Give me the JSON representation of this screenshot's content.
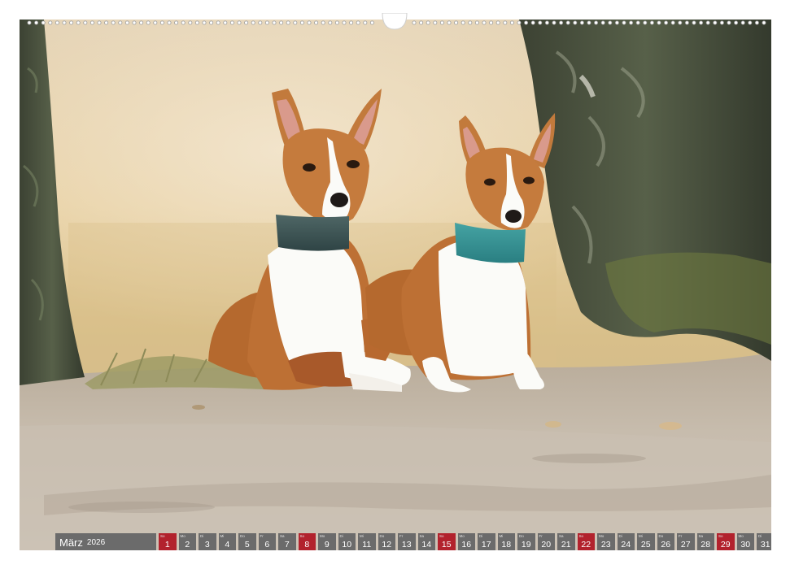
{
  "calendar": {
    "month": "März",
    "year": "2026",
    "days": [
      {
        "wd": "So",
        "num": "1",
        "sun": true
      },
      {
        "wd": "Mo",
        "num": "2",
        "sun": false
      },
      {
        "wd": "Di",
        "num": "3",
        "sun": false
      },
      {
        "wd": "Mi",
        "num": "4",
        "sun": false
      },
      {
        "wd": "Do",
        "num": "5",
        "sun": false
      },
      {
        "wd": "Fr",
        "num": "6",
        "sun": false
      },
      {
        "wd": "Sa",
        "num": "7",
        "sun": false
      },
      {
        "wd": "So",
        "num": "8",
        "sun": true
      },
      {
        "wd": "Mo",
        "num": "9",
        "sun": false
      },
      {
        "wd": "Di",
        "num": "10",
        "sun": false
      },
      {
        "wd": "Mi",
        "num": "11",
        "sun": false
      },
      {
        "wd": "Do",
        "num": "12",
        "sun": false
      },
      {
        "wd": "Fr",
        "num": "13",
        "sun": false
      },
      {
        "wd": "Sa",
        "num": "14",
        "sun": false
      },
      {
        "wd": "So",
        "num": "15",
        "sun": true
      },
      {
        "wd": "Mo",
        "num": "16",
        "sun": false
      },
      {
        "wd": "Di",
        "num": "17",
        "sun": false
      },
      {
        "wd": "Mi",
        "num": "18",
        "sun": false
      },
      {
        "wd": "Do",
        "num": "19",
        "sun": false
      },
      {
        "wd": "Fr",
        "num": "20",
        "sun": false
      },
      {
        "wd": "Sa",
        "num": "21",
        "sun": false
      },
      {
        "wd": "So",
        "num": "22",
        "sun": true
      },
      {
        "wd": "Mo",
        "num": "23",
        "sun": false
      },
      {
        "wd": "Di",
        "num": "24",
        "sun": false
      },
      {
        "wd": "Mi",
        "num": "25",
        "sun": false
      },
      {
        "wd": "Do",
        "num": "26",
        "sun": false
      },
      {
        "wd": "Fr",
        "num": "27",
        "sun": false
      },
      {
        "wd": "Sa",
        "num": "28",
        "sun": false
      },
      {
        "wd": "So",
        "num": "29",
        "sun": true
      },
      {
        "wd": "Mo",
        "num": "30",
        "sun": false
      },
      {
        "wd": "Di",
        "num": "31",
        "sun": false
      }
    ]
  },
  "colors": {
    "cell": "#6b6b6b",
    "sunday": "#b2222d"
  }
}
